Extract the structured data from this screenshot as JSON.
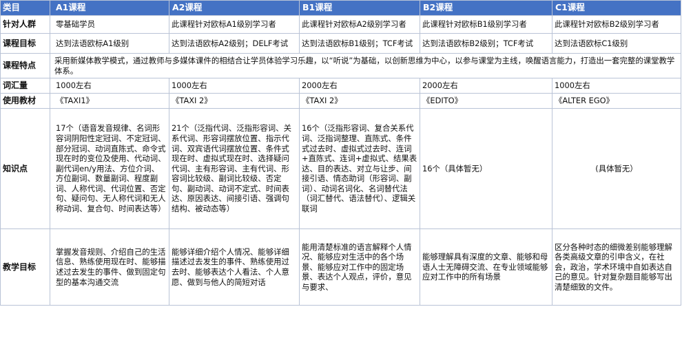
{
  "columns": [
    "类目",
    "A1课程",
    "A2课程",
    "B1课程",
    "B2课程",
    "C1课程"
  ],
  "rows": {
    "target": {
      "label": "针对人群",
      "a1": "零基础学员",
      "a2": "此课程针对欧标A1级别学习者",
      "b1": "此课程针对欧标A2级别学习者",
      "b2": "此课程针对欧标B1级别学习者",
      "c1": "此课程针对欧标B2级别学习者"
    },
    "goal": {
      "label": "课程目标",
      "a1": "达到法语欧标A1级别",
      "a2": "达到法语欧标A2级别；DELF考试",
      "b1": "达到法语欧标B1级别；TCF考试",
      "b2": "达到法语欧标B2级别；TCF考试",
      "c1": "达到法语欧标C1级别"
    },
    "features": {
      "label": "课程特点",
      "text": "采用新媒体教学模式，通过教师与多媒体课件的相结合让学员体验学习乐趣，以“听说”为基础，以创新思维为中心，以参与课堂为主线，唤醒语言能力，打造出一套完整的课堂教学体系。"
    },
    "vocab": {
      "label": "词汇量",
      "a1": "1000左右",
      "a2": "1000左右",
      "b1": "2000左右",
      "b2": "2000左右",
      "c1": "1000左右"
    },
    "textbook": {
      "label": "使用教材",
      "a1": "《TAXI1》",
      "a2": "《TAXI 2》",
      "b1": "《TAXI 2》",
      "b2": "《EDITO》",
      "c1": "《ALTER EGO》"
    },
    "knowledge": {
      "label": "知识点",
      "a1": "17个（语音发音规律、名词形容词阴阳性定冠词、不定冠词、部分冠词、动词直陈式、命令式现在时的变位及使用、代动词、副代词en/y用法、方位介词、方位副词、数量副词、程度副词、人称代词、代词位置、否定句、疑问句、无人称代词和无人称动词、复合句、时间表达等）",
      "a2": "21个（泛指代词、泛指形容词、关系代词、形容词摆放位置、指示代词、双宾语代词摆放位置、条件式现在时、虚拟式现在时、选择疑问代词、主有形容词、主有代词、形容词比较级、副词比较级、否定句、副动词、动词不定式、时间表达、原因表达、间接引语、强调句结构、被动态等）",
      "b1": "16个（泛指形容词、复合关系代词、泛指词整理、直陈式、条件式过去时、虚拟式过去时、连词+直陈式、连词+虚拟式、结果表达、目的表达、对立与让步、间接引语、情态助词（形容词、副词）、动词名词化、名词替代法（词汇替代、语法替代）、逻辑关联词",
      "b2": "16个（具体暂无）",
      "c1": "(具体暂无）"
    },
    "teaching": {
      "label": "教学目标",
      "a1": "掌握发音规则、介绍自己的生活信息、熟练使用现在时、能够描述过去发生的事件、做到固定句型的基本沟通交流",
      "a2": "能够详细介绍个人情况、能够详细描述过去发生的事件、熟练使用过去时、能够表达个人看法、个人意愿、做到与他人的简短对话",
      "b1": "能用清楚标准的语言解释个人情况、能够应对生活中的各个场景、能够应对工作中的固定场景、表达个人观点，评价，意见与要求、",
      "b2": "能够理解具有深度的文章、能够和母语人士无障碍交流、在专业领域能够应对工作中的所有场景",
      "c1": "区分各种时态的细微差别能够理解各类高级文章的引申含义，在社会，政治，学术环境中自如表达自己的意见。针对复杂题目能够写出清楚细致的文件。"
    }
  },
  "colors": {
    "header_bg": "#4472c4",
    "header_text": "#ffffff",
    "border": "#b9c3d6"
  },
  "icons": {
    "logo": "swoosh-logo"
  }
}
